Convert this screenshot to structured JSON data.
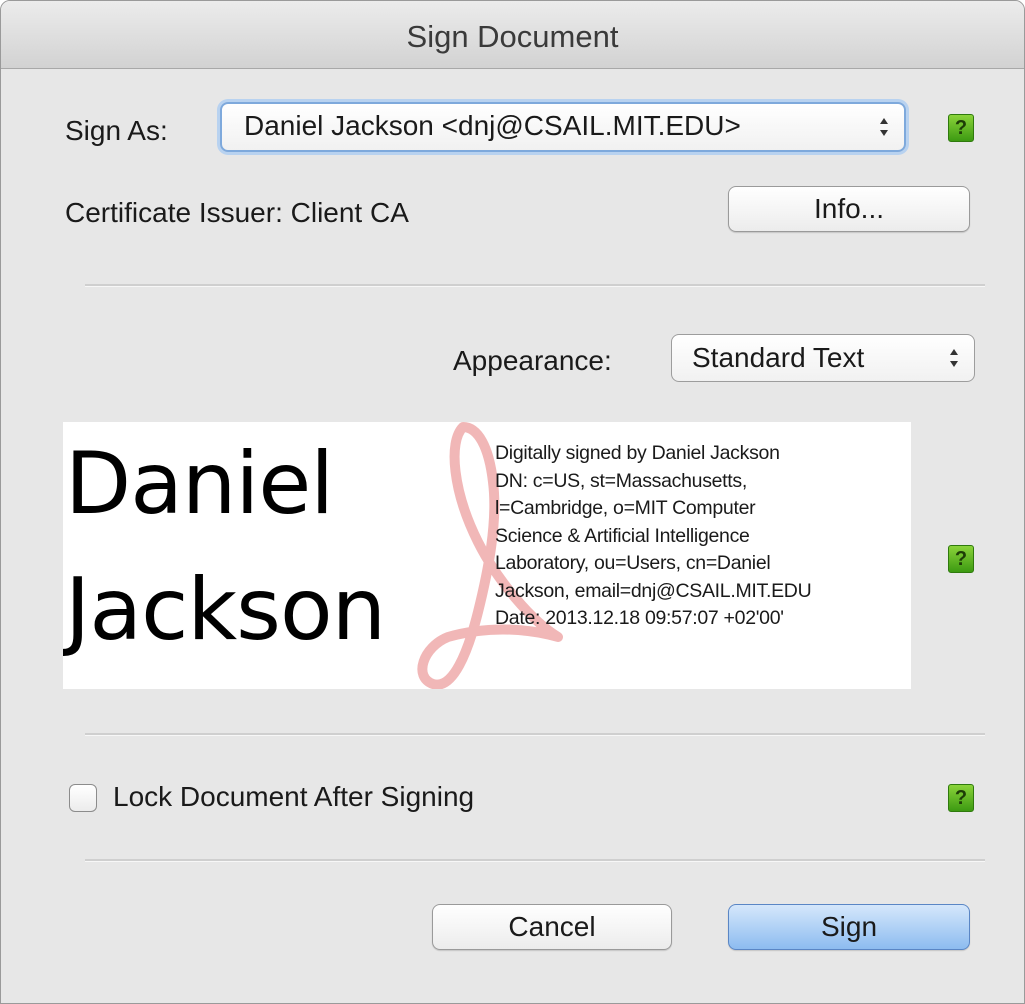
{
  "window": {
    "title": "Sign Document"
  },
  "sign_as": {
    "label": "Sign As:",
    "selected": "Daniel Jackson <dnj@CSAIL.MIT.EDU>",
    "help": "?"
  },
  "certificate": {
    "issuer_text": "Certificate Issuer: Client CA",
    "info_button": "Info..."
  },
  "appearance": {
    "label": "Appearance:",
    "selected": "Standard Text"
  },
  "preview": {
    "name_line1": "Daniel",
    "name_line2": "Jackson",
    "info_lines": [
      "Digitally signed by Daniel Jackson",
      "DN: c=US, st=Massachusetts,",
      "l=Cambridge, o=MIT Computer",
      "Science & Artificial Intelligence",
      "Laboratory, ou=Users, cn=Daniel",
      "Jackson, email=dnj@CSAIL.MIT.EDU",
      "Date: 2013.12.18 09:57:07 +02'00'"
    ],
    "help": "?"
  },
  "lock": {
    "label": "Lock Document After Signing",
    "checked": false,
    "help": "?"
  },
  "buttons": {
    "cancel": "Cancel",
    "sign": "Sign"
  },
  "icons": {
    "help_icon": "help-icon",
    "watermark": "acrobat-logo-icon",
    "popup_arrows": "up-down-arrows-icon"
  }
}
